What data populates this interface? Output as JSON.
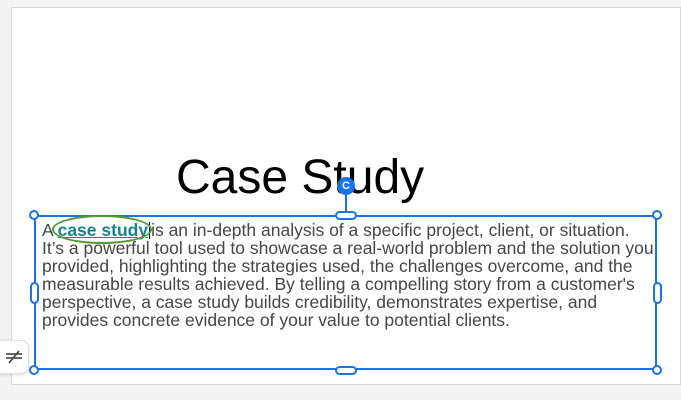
{
  "slide": {
    "title": "Case Study",
    "body_lead": "A",
    "keyword": "case study",
    "body_rest": "is an in-depth analysis of a specific project, client, or situation. It’s a powerful tool used to showcase a real-world problem and the solution you provided, highlighting the strategies used, the challenges overcome, and the measurable results achieved. By telling a compelling story from a customer's perspective, a case study builds credibility, demonstrates expertise, and provides concrete evidence of your value to potential clients."
  },
  "rotate_handle": {
    "glyph": "C",
    "icon": "rotate-icon"
  },
  "side_button": {
    "icon": "strikethrough-toggle-icon"
  },
  "colors": {
    "selection": "#1a73e8",
    "keyword": "#12878a",
    "highlight_ring": "#4f9c30",
    "body_text": "#444746"
  }
}
